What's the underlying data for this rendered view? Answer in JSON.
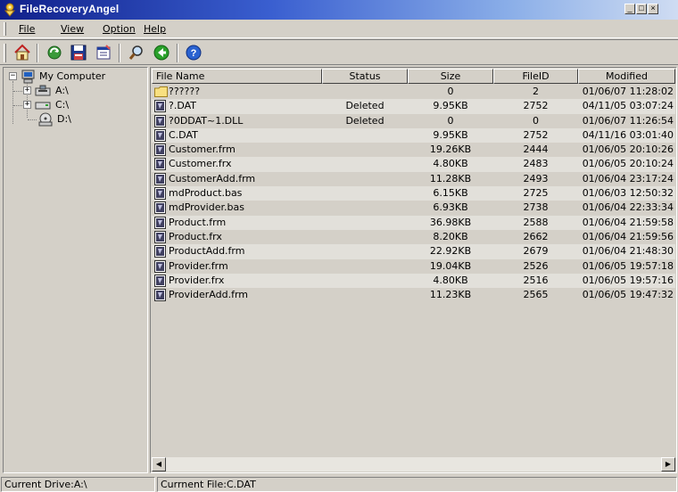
{
  "window": {
    "title": "FileRecoveryAngel",
    "controls": [
      "minimize",
      "maximize",
      "close"
    ]
  },
  "menu": {
    "items": [
      {
        "label": "File",
        "access": "F"
      },
      {
        "label": "View",
        "access": "V"
      },
      {
        "label": "Option",
        "access": "O"
      },
      {
        "label": "Help",
        "access": "H"
      }
    ]
  },
  "toolbar": {
    "buttons": [
      {
        "name": "home",
        "icon": "home-icon"
      },
      {
        "name": "refresh",
        "icon": "refresh-icon"
      },
      {
        "name": "save",
        "icon": "floppy-save-icon"
      },
      {
        "name": "properties",
        "icon": "properties-icon"
      },
      {
        "name": "search",
        "icon": "magnifier-icon"
      },
      {
        "name": "back",
        "icon": "green-back-arrow-icon"
      },
      {
        "name": "help",
        "icon": "help-icon"
      }
    ]
  },
  "tree": {
    "root": "My Computer",
    "drives": [
      "A:\\",
      "C:\\",
      "D:\\"
    ]
  },
  "list": {
    "columns": [
      "File Name",
      "Status",
      "Size",
      "FileID",
      "Modified"
    ],
    "rows": [
      {
        "name": "??????",
        "status": "",
        "size": "0",
        "id": "2",
        "modified": "01/06/07 11:28:02",
        "type": "folder"
      },
      {
        "name": "?.DAT",
        "status": "Deleted",
        "size": "9.95KB",
        "id": "2752",
        "modified": "04/11/05 03:07:24",
        "type": "file"
      },
      {
        "name": "?0DDAT~1.DLL",
        "status": "Deleted",
        "size": "0",
        "id": "0",
        "modified": "01/06/07 11:26:54",
        "type": "file"
      },
      {
        "name": "C.DAT",
        "status": "",
        "size": "9.95KB",
        "id": "2752",
        "modified": "04/11/16 03:01:40",
        "type": "file"
      },
      {
        "name": "Customer.frm",
        "status": "",
        "size": "19.26KB",
        "id": "2444",
        "modified": "01/06/05 20:10:26",
        "type": "file"
      },
      {
        "name": "Customer.frx",
        "status": "",
        "size": "4.80KB",
        "id": "2483",
        "modified": "01/06/05 20:10:24",
        "type": "file"
      },
      {
        "name": "CustomerAdd.frm",
        "status": "",
        "size": "11.28KB",
        "id": "2493",
        "modified": "01/06/04 23:17:24",
        "type": "file"
      },
      {
        "name": "mdProduct.bas",
        "status": "",
        "size": "6.15KB",
        "id": "2725",
        "modified": "01/06/03 12:50:32",
        "type": "file"
      },
      {
        "name": "mdProvider.bas",
        "status": "",
        "size": "6.93KB",
        "id": "2738",
        "modified": "01/06/04 22:33:34",
        "type": "file"
      },
      {
        "name": "Product.frm",
        "status": "",
        "size": "36.98KB",
        "id": "2588",
        "modified": "01/06/04 21:59:58",
        "type": "file"
      },
      {
        "name": "Product.frx",
        "status": "",
        "size": "8.20KB",
        "id": "2662",
        "modified": "01/06/04 21:59:56",
        "type": "file"
      },
      {
        "name": "ProductAdd.frm",
        "status": "",
        "size": "22.92KB",
        "id": "2679",
        "modified": "01/06/04 21:48:30",
        "type": "file"
      },
      {
        "name": "Provider.frm",
        "status": "",
        "size": "19.04KB",
        "id": "2526",
        "modified": "01/06/05 19:57:18",
        "type": "file"
      },
      {
        "name": "Provider.frx",
        "status": "",
        "size": "4.80KB",
        "id": "2516",
        "modified": "01/06/05 19:57:16",
        "type": "file"
      },
      {
        "name": "ProviderAdd.frm",
        "status": "",
        "size": "11.23KB",
        "id": "2565",
        "modified": "01/06/05 19:47:32",
        "type": "file"
      }
    ]
  },
  "statusbar": {
    "drive": "Current Drive:A:\\",
    "file": "Currnent File:C.DAT"
  }
}
